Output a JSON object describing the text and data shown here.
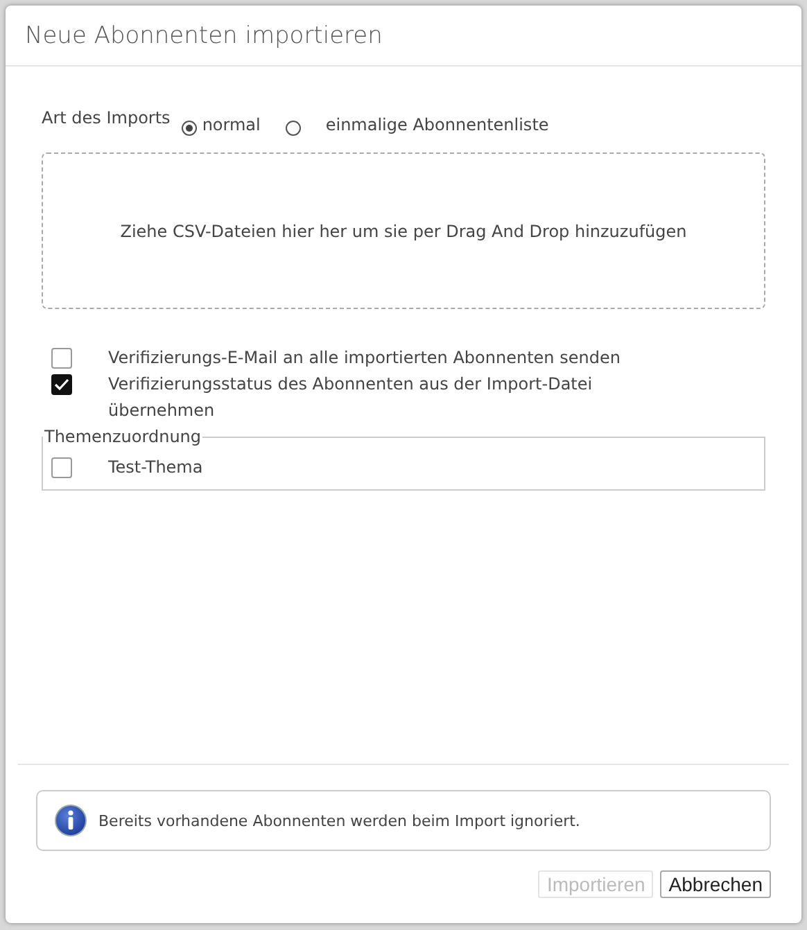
{
  "dialog": {
    "title": "Neue Abonnenten importieren"
  },
  "import_type": {
    "label": "Art des Imports",
    "options": [
      {
        "label": "normal",
        "selected": true
      },
      {
        "label": "einmalige Abonnentenliste",
        "selected": false
      }
    ]
  },
  "dropzone": {
    "text": "Ziehe CSV-Dateien hier her um sie per Drag And Drop hinzuzufügen"
  },
  "options": [
    {
      "label": "Verifizierungs-E-Mail an alle importierten Abonnenten senden",
      "checked": false
    },
    {
      "label": "Verifizierungsstatus des Abonnenten aus der Import-Datei übernehmen",
      "checked": true
    }
  ],
  "topics": {
    "legend": "Themenzuordnung",
    "items": [
      {
        "label": "Test-Thema",
        "checked": false
      }
    ]
  },
  "info": {
    "text": "Bereits vorhandene Abonnenten werden beim Import ignoriert."
  },
  "buttons": [
    {
      "label": "Importieren",
      "disabled": true
    },
    {
      "label": "Abbrechen",
      "disabled": false
    }
  ]
}
